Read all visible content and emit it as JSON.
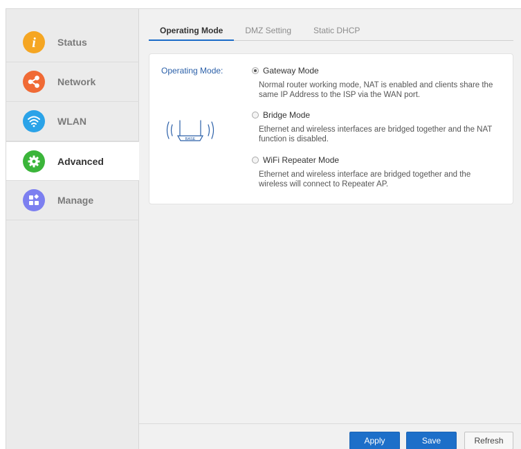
{
  "sidebar": {
    "items": [
      {
        "label": "Status",
        "icon": "info-icon",
        "color": "#f5a623"
      },
      {
        "label": "Network",
        "icon": "share-icon",
        "color": "#f06a35"
      },
      {
        "label": "WLAN",
        "icon": "wifi-icon",
        "color": "#2ba3e8"
      },
      {
        "label": "Advanced",
        "icon": "gear-icon",
        "color": "#3bb53a",
        "active": true
      },
      {
        "label": "Manage",
        "icon": "apps-icon",
        "color": "#7c7ff0"
      }
    ]
  },
  "tabs": [
    {
      "label": "Operating Mode",
      "active": true
    },
    {
      "label": "DMZ Setting"
    },
    {
      "label": "Static DHCP"
    }
  ],
  "panel": {
    "field_label": "Operating Mode:",
    "router_label": "BASE",
    "options": [
      {
        "title": "Gateway Mode",
        "selected": true,
        "desc": "Normal router working mode, NAT is enabled and clients share the same IP Address to the ISP via the WAN port."
      },
      {
        "title": "Bridge Mode",
        "selected": false,
        "desc": "Ethernet and wireless interfaces are bridged together and the NAT function is disabled."
      },
      {
        "title": "WiFi Repeater Mode",
        "selected": false,
        "desc": "Ethernet and wireless interface are bridged together and the wireless will connect to Repeater AP."
      }
    ]
  },
  "footer": {
    "apply_label": "Apply",
    "save_label": "Save",
    "refresh_label": "Refresh"
  },
  "colors": {
    "accent": "#1d6fc9",
    "label_blue": "#2a5fa8"
  }
}
